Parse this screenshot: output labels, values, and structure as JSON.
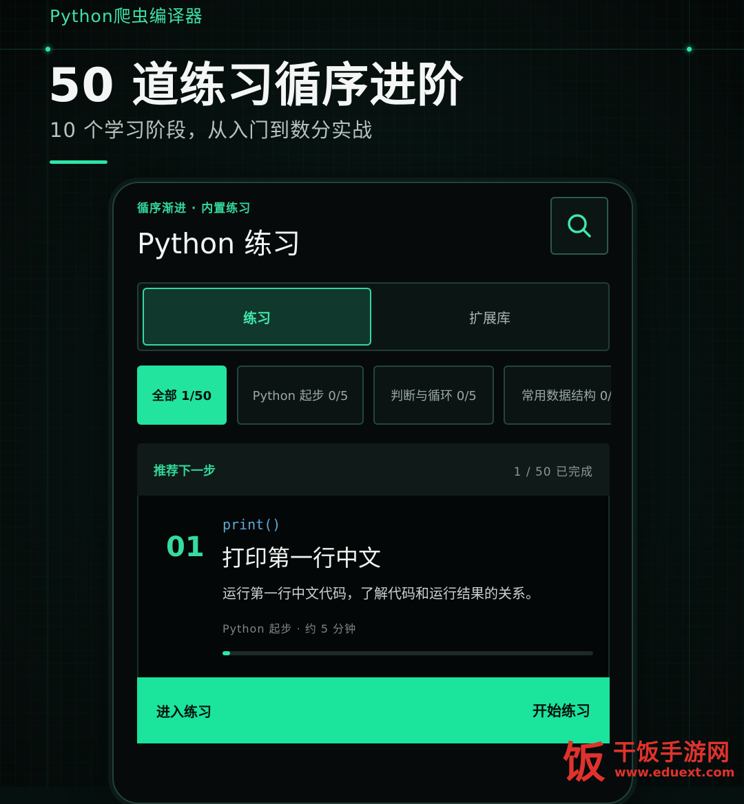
{
  "header": {
    "eyebrow": "Python爬虫编译器",
    "title": "50 道练习循序进阶",
    "subtitle": "10 个学习阶段，从入门到数分实战"
  },
  "app": {
    "eyebrow": "循序渐进 · 内置练习",
    "title": "Python 练习",
    "search_icon": "search-icon",
    "segments": [
      {
        "label": "练习",
        "active": true
      },
      {
        "label": "扩展库",
        "active": false
      }
    ],
    "chips": [
      {
        "label": "全部 1/50",
        "active": true
      },
      {
        "label": "Python 起步 0/5",
        "active": false
      },
      {
        "label": "判断与循环 0/5",
        "active": false
      },
      {
        "label": "常用数据结构 0/",
        "active": false
      }
    ],
    "card": {
      "label": "推荐下一步",
      "progress": "1 / 50 已完成",
      "number": "01",
      "function": "print()",
      "title": "打印第一行中文",
      "description": "运行第一行中文代码，了解代码和运行结果的关系。",
      "meta": "Python 起步 · 约 5 分钟",
      "progress_fraction": 0.02,
      "cta_left": "进入练习",
      "cta_right": "开始练习"
    }
  },
  "watermark": {
    "logo_char": "饭",
    "name": "干饭手游网",
    "url": "www.eduext.com"
  },
  "colors": {
    "accent": "#2ee6a8",
    "background": "#06100f",
    "cta": "#1be49d",
    "watermark": "#e0322c"
  }
}
